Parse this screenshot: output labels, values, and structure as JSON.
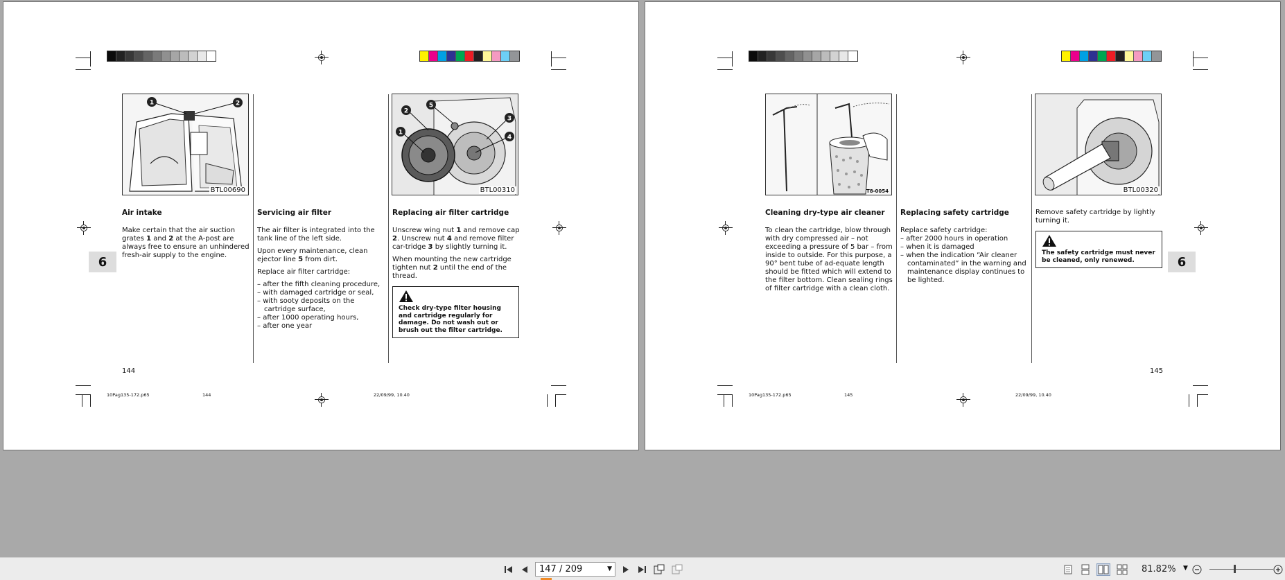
{
  "left_page": {
    "fig1_code": "BTL00690",
    "fig3_code": "BTL00310",
    "col1": {
      "title": "Air intake",
      "body_html": "Make certain that the air suction grates <b>1</b> and <b>2</b> at the A-post are always free to ensure an unhindered fresh-air supply to the engine."
    },
    "col2": {
      "title": "Servicing air filter",
      "p1": "The air filter is integrated into the tank line of the left side.",
      "p2_html": "Upon every maintenance, clean ejector line <b>5</b> from dirt.",
      "p3": "Replace air filter cartridge:",
      "items": [
        "after the fifth cleaning procedure,",
        "with damaged cartridge or seal,",
        "with sooty deposits on the cartridge surface,",
        "after 1000 operating hours,",
        "after one year"
      ]
    },
    "col3": {
      "title": "Replacing air filter cartridge",
      "p1_html": "Unscrew wing nut <b>1</b> and remove cap <b>2</b>. Unscrew nut <b>4</b> and remove filter car-tridge <b>3</b> by slightly turning it.",
      "p2_html": "When mounting the new cartridge tighten nut <b>2</b> until the end of the thread.",
      "warning": "Check dry-type filter housing and cartridge regularly for damage. Do not wash out or brush out the filter cartridge."
    },
    "chapter": "6",
    "page_number": "144",
    "slug_file": "10Pag135-172.p65",
    "slug_page": "144",
    "slug_date": "22/09/99, 10.40"
  },
  "right_page": {
    "fig1_code": "T8-0054",
    "fig3_code": "BTL00320",
    "col1": {
      "title": "Cleaning dry-type air cleaner",
      "body": "To clean the cartridge, blow through with dry compressed air – not exceeding a pressure of 5 bar – from inside to outside. For this purpose, a 90° bent tube of ad-equate length should be fitted which will extend to the filter bottom. Clean sealing rings of filter cartridge with a clean cloth."
    },
    "col2": {
      "title": "Replacing safety cartridge",
      "p1": "Replace safety cartridge:",
      "items": [
        "after 2000 hours in operation",
        "when it is damaged",
        "when the indication “Air cleaner contaminated” in the warning and maintenance display continues to be lighted."
      ]
    },
    "col3": {
      "body": "Remove safety cartridge by lightly turning it.",
      "warning": "The safety cartridge must never be cleaned, only renewed."
    },
    "chapter": "6",
    "page_number": "145",
    "slug_file": "10Pag135-172.p65",
    "slug_page": "145",
    "slug_date": "22/09/99, 10.40"
  },
  "callouts": {
    "left_fig1": [
      "1",
      "2"
    ],
    "left_fig3": [
      "1",
      "2",
      "3",
      "4",
      "5"
    ]
  },
  "colors": {
    "grays": [
      "#0b0b0b",
      "#222222",
      "#383838",
      "#4e4e4e",
      "#646464",
      "#7a7a7a",
      "#909090",
      "#a6a6a6",
      "#bcbcbc",
      "#d2d2d2",
      "#e8e8e8",
      "#ffffff"
    ],
    "process": [
      "#fff200",
      "#ec008c",
      "#00a0e3",
      "#2e3192",
      "#00a651",
      "#ed1c24",
      "#231f20",
      "#fff799",
      "#f49ac1",
      "#6dcff6",
      "#939598"
    ],
    "toolbar_accent": "#f08a24"
  },
  "toolbar": {
    "page_indicator": "147 / 209",
    "zoom": "81.82%",
    "icons": [
      "first-page-icon",
      "prev-page-icon",
      "next-page-icon",
      "last-page-icon",
      "fit-page-icon",
      "fit-width-icon",
      "single-page-view-icon",
      "continuous-view-icon",
      "two-page-view-icon",
      "two-page-continuous-icon",
      "zoom-out-icon",
      "zoom-in-icon"
    ]
  }
}
